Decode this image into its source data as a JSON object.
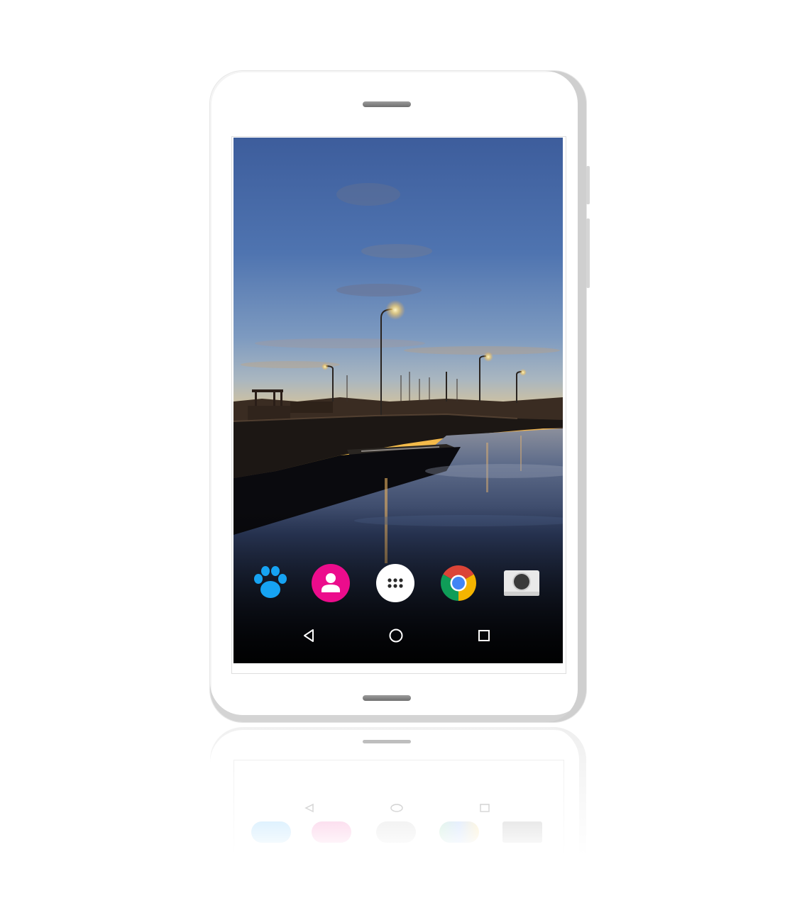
{
  "device": {
    "type": "android-phone",
    "color": "#ffffff"
  },
  "wallpaper": {
    "description": "harbor-sunset",
    "sky_top_color": "#4a6ea8",
    "horizon_color": "#f2a73a",
    "water_color": "#1a2440"
  },
  "dock": {
    "apps": [
      {
        "name": "paw-app",
        "icon": "paw-icon",
        "color": "#1aa0f0"
      },
      {
        "name": "contacts",
        "icon": "person-icon",
        "color": "#ec0f8c"
      },
      {
        "name": "app-drawer",
        "icon": "grid-dots-icon",
        "color": "#ffffff"
      },
      {
        "name": "chrome",
        "icon": "chrome-icon",
        "color": "#4285f4"
      },
      {
        "name": "camera",
        "icon": "camera-icon",
        "color": "#e6e6e6"
      }
    ]
  },
  "navbar": {
    "buttons": [
      {
        "name": "back",
        "icon": "back-triangle-icon"
      },
      {
        "name": "home",
        "icon": "home-circle-icon"
      },
      {
        "name": "recents",
        "icon": "recents-square-icon"
      }
    ],
    "icon_color": "#ffffff"
  }
}
